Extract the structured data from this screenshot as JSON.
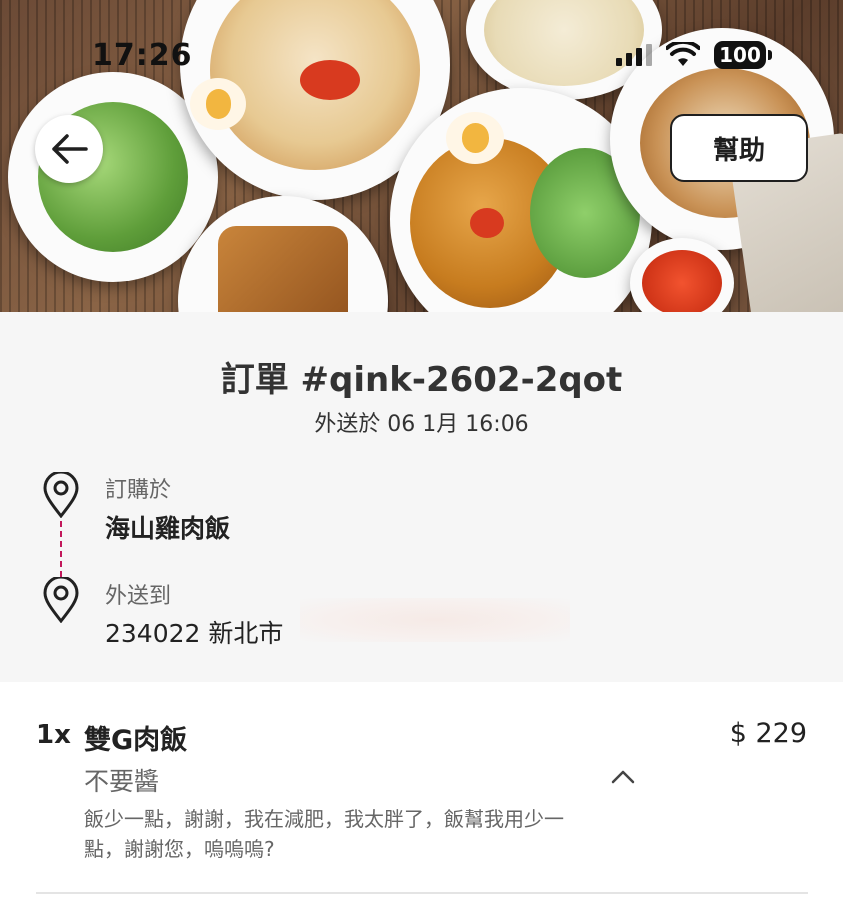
{
  "status_bar": {
    "time": "17:26",
    "battery": "100"
  },
  "header": {
    "help_label": "幫助"
  },
  "order": {
    "title": "訂單 #qink-2602-2qot",
    "delivered_at": "外送於 06 1月 16:06",
    "ordered_from_label": "訂購於",
    "restaurant": "海山雞肉飯",
    "deliver_to_label": "外送到",
    "address": "234022 新北市"
  },
  "items": [
    {
      "quantity": "1x",
      "name": "雙G肉飯",
      "price": "$ 229",
      "option": "不要醬",
      "note": "飯少一點，謝謝，我在減肥，我太胖了，飯幫我用少一點，謝謝您，嗚嗚嗚?"
    }
  ],
  "colors": {
    "accent": "#c2185b",
    "summary_bg": "#f6f6f6"
  },
  "icons": [
    "back-arrow-icon",
    "location-pin-icon",
    "chevron-up-icon",
    "signal-icon",
    "wifi-icon",
    "battery-icon"
  ]
}
